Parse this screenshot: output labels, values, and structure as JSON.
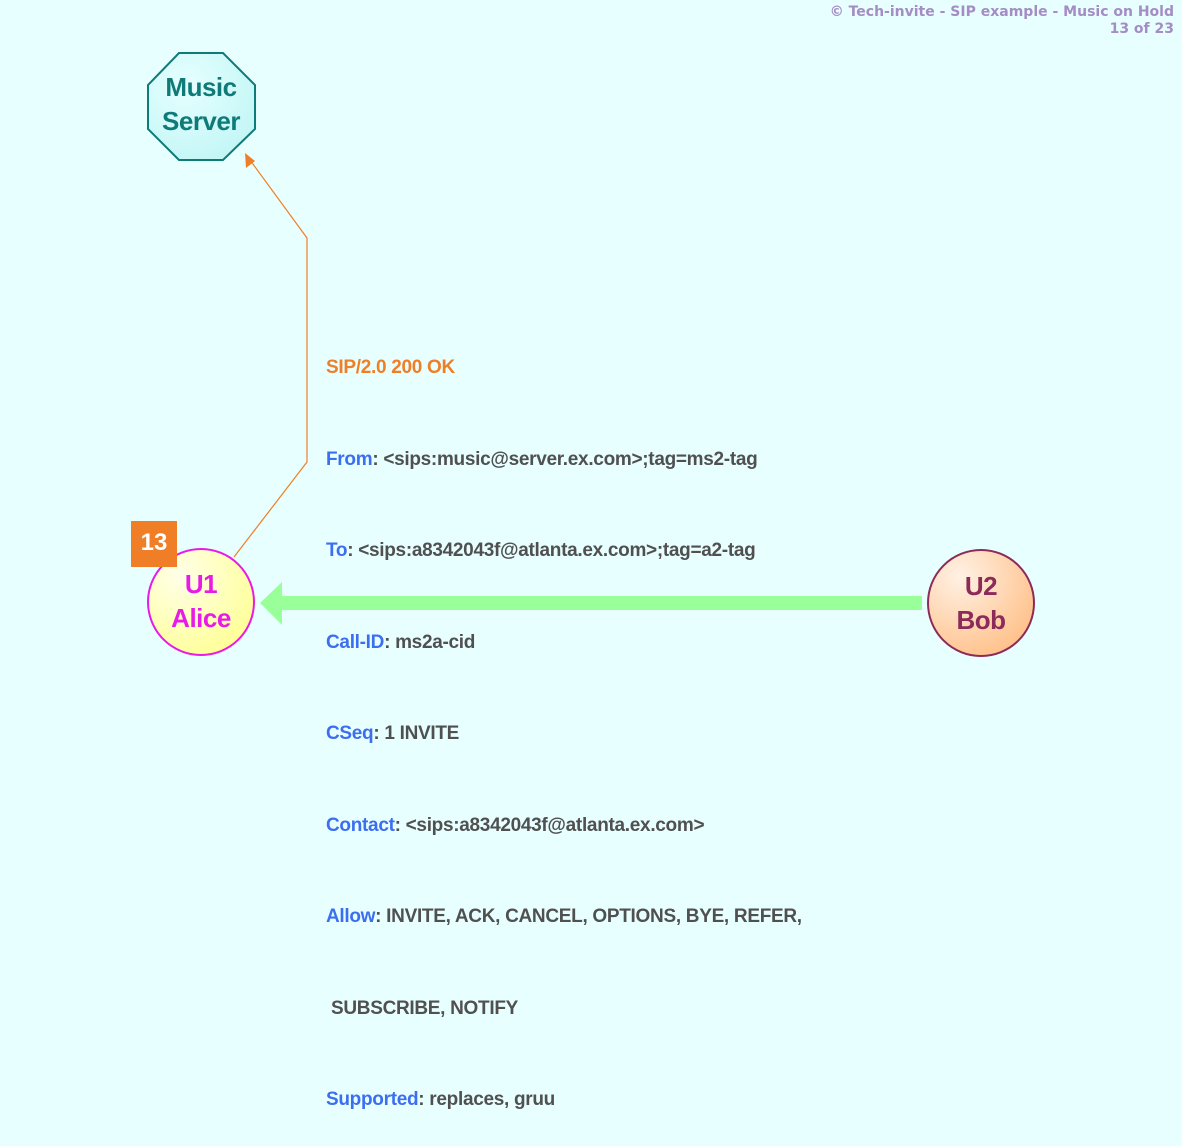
{
  "header": {
    "title": "© Tech-invite - SIP example - Music on Hold",
    "page": "13 of 23"
  },
  "colors": {
    "background": "#e8ffff",
    "header_text": "#a48cc4",
    "status_line": "#f07e26",
    "header_name": "#3c6ef0",
    "header_value": "#505050",
    "signal_line": "#f07e26",
    "media_arrow": "#99ff99"
  },
  "nodes": {
    "music_server": {
      "line1": "Music",
      "line2": "Server"
    },
    "alice": {
      "line1": "U1",
      "line2": "Alice"
    },
    "bob": {
      "line1": "U2",
      "line2": "Bob"
    }
  },
  "step": {
    "number": "13"
  },
  "message": {
    "status_line": "SIP/2.0 200 OK",
    "headers": [
      {
        "name": "From",
        "value": ": <sips:music@server.ex.com>;tag=ms2-tag"
      },
      {
        "name": "To",
        "value": ": <sips:a8342043f@atlanta.ex.com>;tag=a2-tag"
      },
      {
        "name": "Call-ID",
        "value": ": ms2a-cid"
      },
      {
        "name": "CSeq",
        "value": ": 1 INVITE"
      },
      {
        "name": "Contact",
        "value": ": <sips:a8342043f@atlanta.ex.com>"
      },
      {
        "name": "Allow",
        "value": ": INVITE, ACK, CANCEL, OPTIONS, BYE, REFER,"
      },
      {
        "name": "",
        "value": " SUBSCRIBE, NOTIFY"
      },
      {
        "name": "Supported",
        "value": ": replaces, gruu"
      }
    ]
  },
  "flows": {
    "signaling": {
      "from": "Alice",
      "to": "Music Server",
      "message": "SIP/2.0 200 OK"
    },
    "media": {
      "from": "Bob",
      "to": "Alice"
    }
  }
}
